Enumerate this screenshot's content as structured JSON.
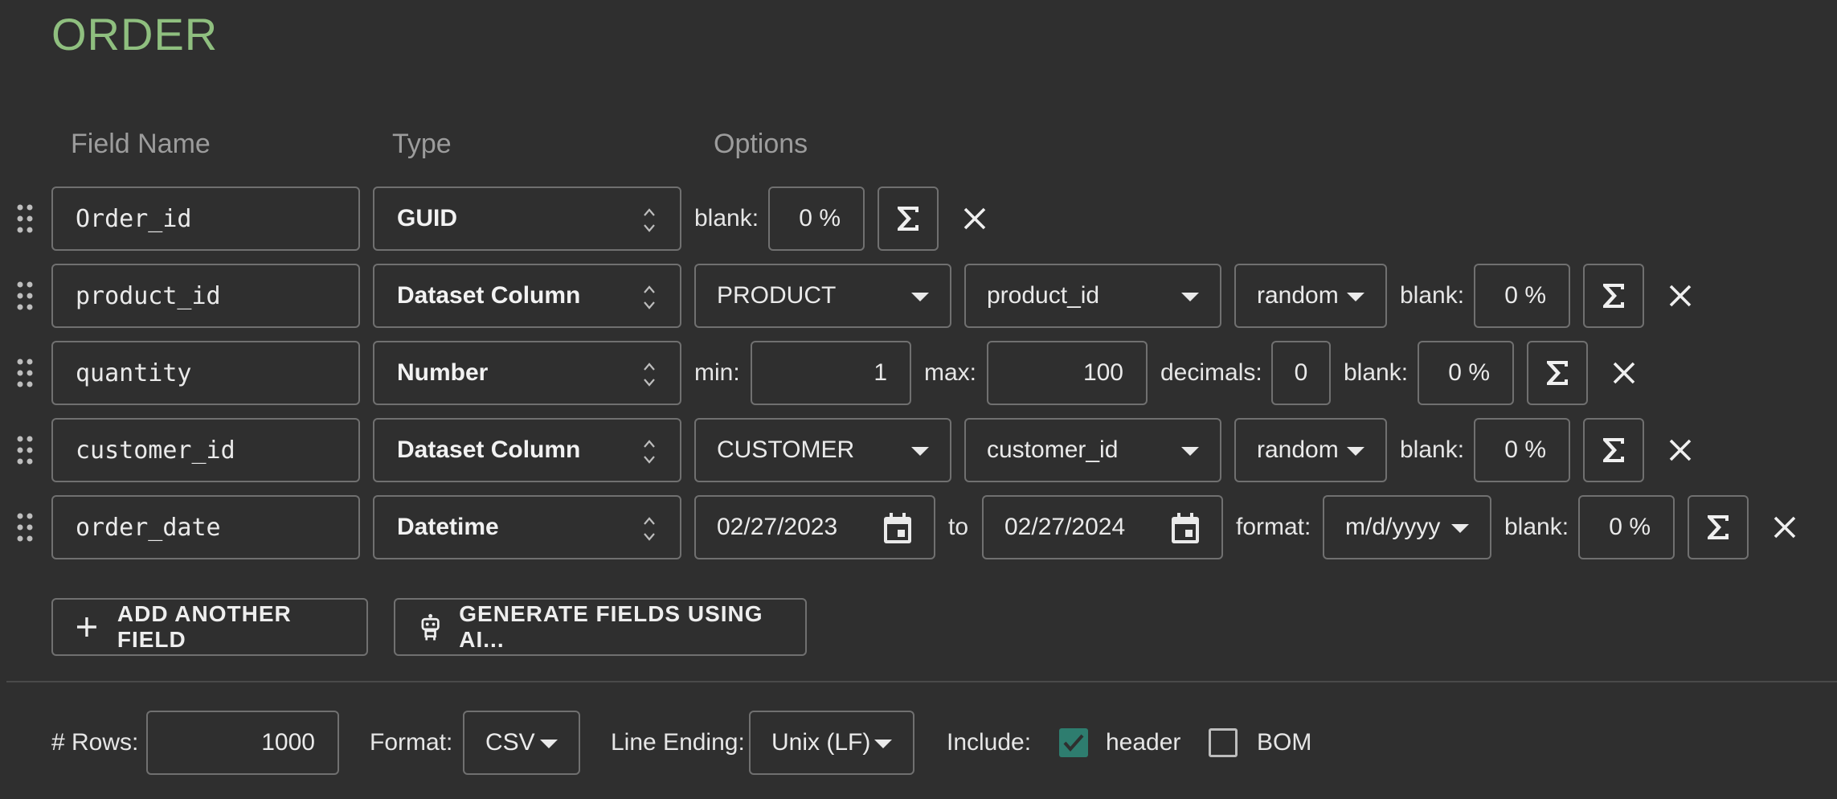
{
  "title": "ORDER",
  "headers": {
    "field_name": "Field Name",
    "type": "Type",
    "options": "Options"
  },
  "rows": [
    {
      "name": "Order_id",
      "type": "GUID",
      "blank_label": "blank:",
      "blank": "0 %"
    },
    {
      "name": "product_id",
      "type": "Dataset Column",
      "dataset": "PRODUCT",
      "column": "product_id",
      "mode": "random",
      "blank_label": "blank:",
      "blank": "0 %"
    },
    {
      "name": "quantity",
      "type": "Number",
      "min_label": "min:",
      "min": "1",
      "max_label": "max:",
      "max": "100",
      "decimals_label": "decimals:",
      "decimals": "0",
      "blank_label": "blank:",
      "blank": "0 %"
    },
    {
      "name": "customer_id",
      "type": "Dataset Column",
      "dataset": "CUSTOMER",
      "column": "customer_id",
      "mode": "random",
      "blank_label": "blank:",
      "blank": "0 %"
    },
    {
      "name": "order_date",
      "type": "Datetime",
      "from": "02/27/2023",
      "to_label": "to",
      "to": "02/27/2024",
      "format_label": "format:",
      "format": "m/d/yyyy",
      "blank_label": "blank:",
      "blank": "0 %"
    }
  ],
  "buttons": {
    "add_field": "ADD ANOTHER FIELD",
    "generate_ai": "GENERATE FIELDS USING AI..."
  },
  "footer": {
    "rows_label": "# Rows:",
    "rows": "1000",
    "format_label": "Format:",
    "format": "CSV",
    "line_ending_label": "Line Ending:",
    "line_ending": "Unix (LF)",
    "include_label": "Include:",
    "header_label": "header",
    "header_checked": true,
    "bom_label": "BOM",
    "bom_checked": false
  },
  "colors": {
    "accent": "#8fbf7f",
    "checkbox": "#2e7d6f",
    "background": "#2f2f2f",
    "border": "#707070"
  },
  "icons": [
    "drag-handle-icon",
    "updown-icon",
    "caret-down-icon",
    "sigma-icon",
    "close-icon",
    "calendar-icon",
    "plus-icon",
    "robot-icon",
    "check-icon"
  ]
}
